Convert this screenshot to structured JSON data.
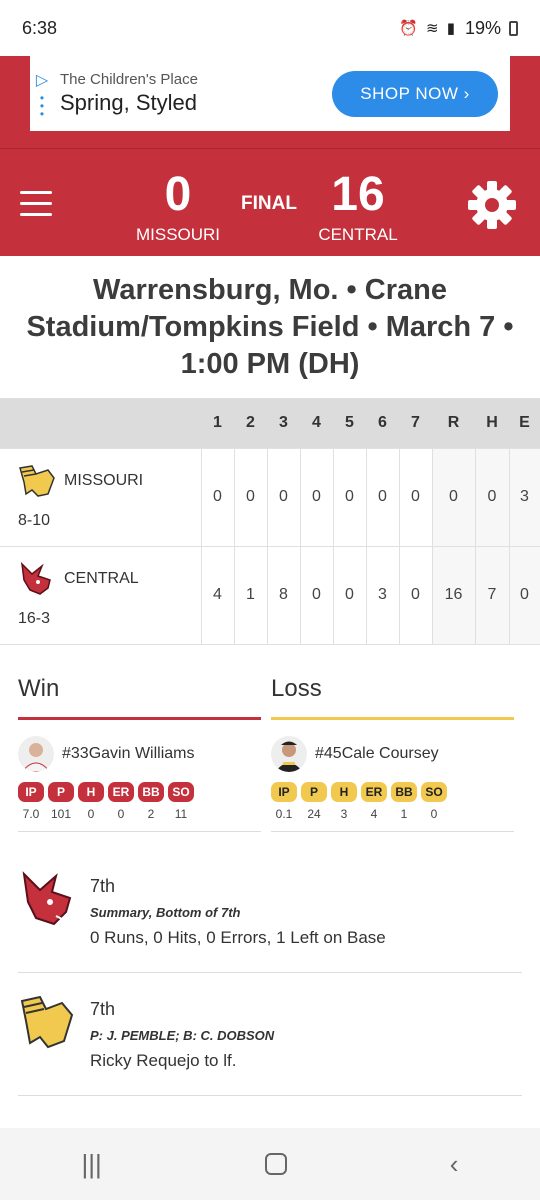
{
  "status": {
    "time": "6:38",
    "battery": "19%",
    "icons": "⏰ ≋ ▮"
  },
  "ad": {
    "brand": "The Children's Place",
    "tagline": "Spring, Styled",
    "cta": "SHOP NOW ›"
  },
  "header": {
    "away": {
      "score": "0",
      "name": "MISSOURI"
    },
    "home": {
      "score": "16",
      "name": "CENTRAL"
    },
    "status": "FINAL"
  },
  "venue": "Warrensburg, Mo. • Crane Stadium/Tompkins Field • March 7 • 1:00 PM (DH)",
  "linescore": {
    "headers": [
      "1",
      "2",
      "3",
      "4",
      "5",
      "6",
      "7",
      "R",
      "H",
      "E"
    ],
    "rows": [
      {
        "team": "MISSOURI",
        "record": "8-10",
        "cells": [
          "0",
          "0",
          "0",
          "0",
          "0",
          "0",
          "0",
          "0",
          "0",
          "3"
        ]
      },
      {
        "team": "CENTRAL",
        "record": "16-3",
        "cells": [
          "4",
          "1",
          "8",
          "0",
          "0",
          "3",
          "0",
          "16",
          "7",
          "0"
        ]
      }
    ]
  },
  "decisions": {
    "win": {
      "title": "Win",
      "pitcher": "#33Gavin Williams",
      "labels": [
        "IP",
        "P",
        "H",
        "ER",
        "BB",
        "SO"
      ],
      "values": [
        "7.0",
        "101",
        "0",
        "0",
        "2",
        "11"
      ]
    },
    "loss": {
      "title": "Loss",
      "pitcher": "#45Cale Coursey",
      "labels": [
        "IP",
        "P",
        "H",
        "ER",
        "BB",
        "SO"
      ],
      "values": [
        "0.1",
        "24",
        "3",
        "4",
        "1",
        "0"
      ]
    }
  },
  "plays": [
    {
      "inning": "7th",
      "sub": "Summary, Bottom of 7th",
      "desc": "0 Runs, 0 Hits, 0 Errors, 1 Left on Base"
    },
    {
      "inning": "7th",
      "sub": "P: J. PEMBLE; B: C. DOBSON",
      "desc": "Ricky Requejo to lf."
    }
  ],
  "colors": {
    "central_red": "#c4303c",
    "missouri_gold": "#f0c94e",
    "ad_blue": "#2d8ce8"
  }
}
